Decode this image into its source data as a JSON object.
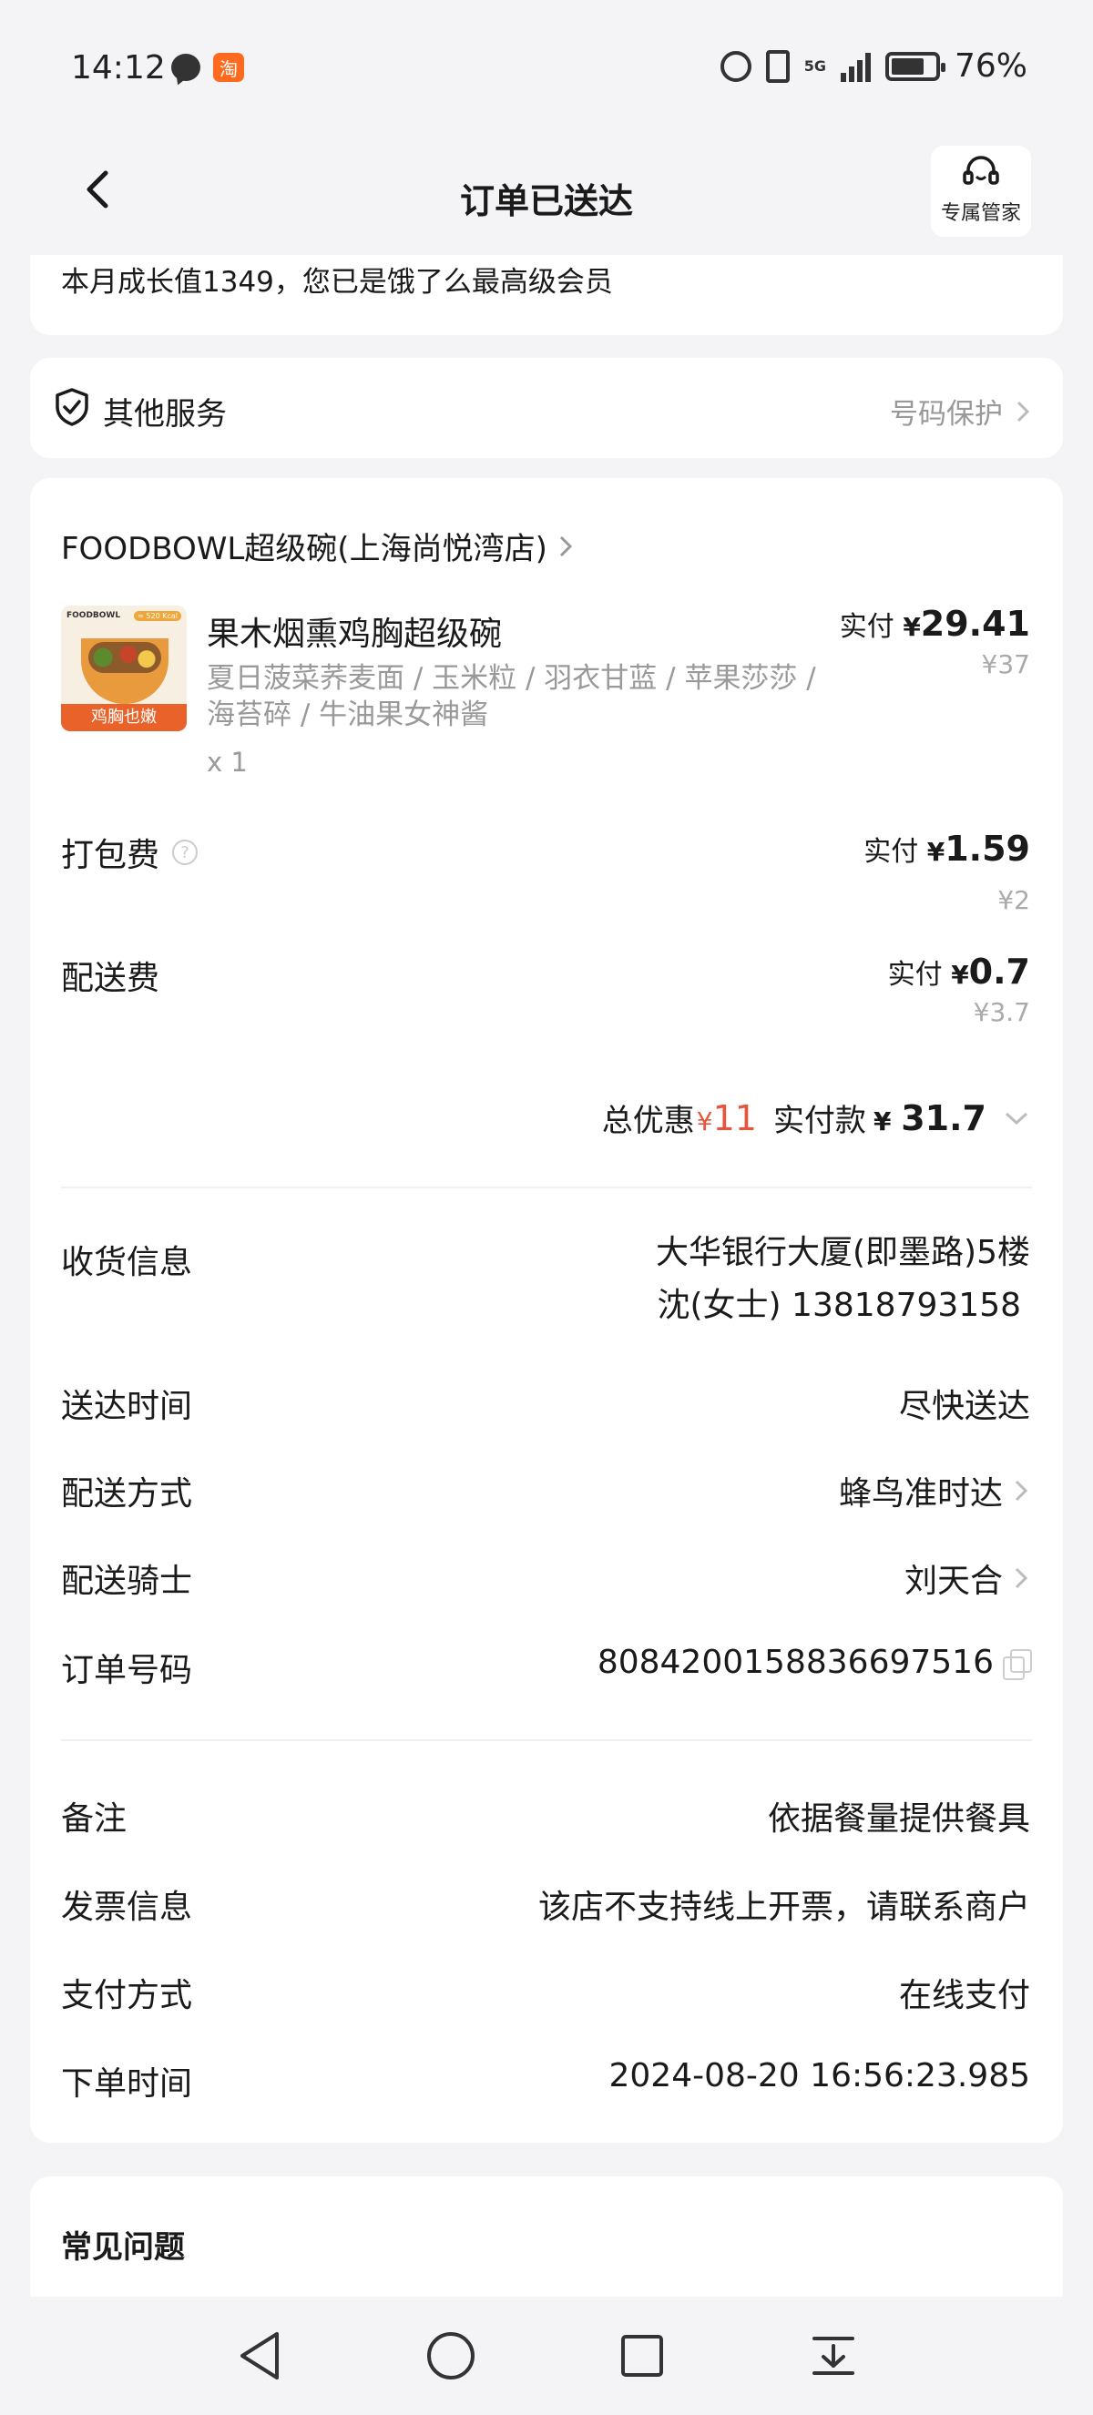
{
  "status_bar": {
    "time": "14:12",
    "battery": "76%",
    "network": "5G"
  },
  "nav": {
    "title": "订单已送达",
    "service_label": "专属管家"
  },
  "membership": {
    "growth_text": "本月成长值1349，您已是饿了么最高级会员"
  },
  "other_service": {
    "title": "其他服务",
    "right_label": "号码保护"
  },
  "order": {
    "shop_name": "FOODBOWL超级碗(上海尚悦湾店)",
    "item": {
      "image_brand": "FOODBOWL",
      "image_kcal": "≈ 520 Kcal",
      "image_tag": "鸡胸也嫩",
      "name": "果木烟熏鸡胸超级碗",
      "desc": "夏日菠菜荞麦面 / 玉米粒 / 羽衣甘蓝 / 苹果莎莎 / 海苔碎 / 牛油果女神酱",
      "qty": "x 1",
      "paid_label": "实付",
      "yen": "¥",
      "paid": "29.41",
      "original": "¥37"
    },
    "packing": {
      "label": "打包费",
      "help": "?",
      "paid_label": "实付",
      "yen": "¥",
      "paid": "1.59",
      "original": "¥2"
    },
    "delivery": {
      "label": "配送费",
      "paid_label": "实付",
      "yen": "¥",
      "paid": "0.7",
      "original": "¥3.7"
    },
    "summary": {
      "discount_label": "总优惠",
      "discount_yen": "¥",
      "discount": "11",
      "paid_label": "实付款",
      "paid_yen": "¥",
      "paid": "31.7"
    }
  },
  "details": {
    "receiver_label": "收货信息",
    "receiver_address": "大华银行大厦(即墨路)5楼",
    "receiver_contact": "沈(女士) 13818793158",
    "arrive_label": "送达时间",
    "arrive_value": "尽快送达",
    "method_label": "配送方式",
    "method_value": "蜂鸟准时达",
    "rider_label": "配送骑士",
    "rider_value": "刘天合",
    "order_no_label": "订单号码",
    "order_no_value": "8084200158836697516",
    "remark_label": "备注",
    "remark_value": "依据餐量提供餐具",
    "invoice_label": "发票信息",
    "invoice_value": "该店不支持线上开票，请联系商户",
    "pay_method_label": "支付方式",
    "pay_method_value": "在线支付",
    "order_time_label": "下单时间",
    "order_time_value": "2024-08-20 16:56:23.985"
  },
  "faq": {
    "title": "常见问题"
  },
  "colors": {
    "accent_red": "#e8543a",
    "background": "#f4f4f6",
    "muted_text": "#999999"
  }
}
